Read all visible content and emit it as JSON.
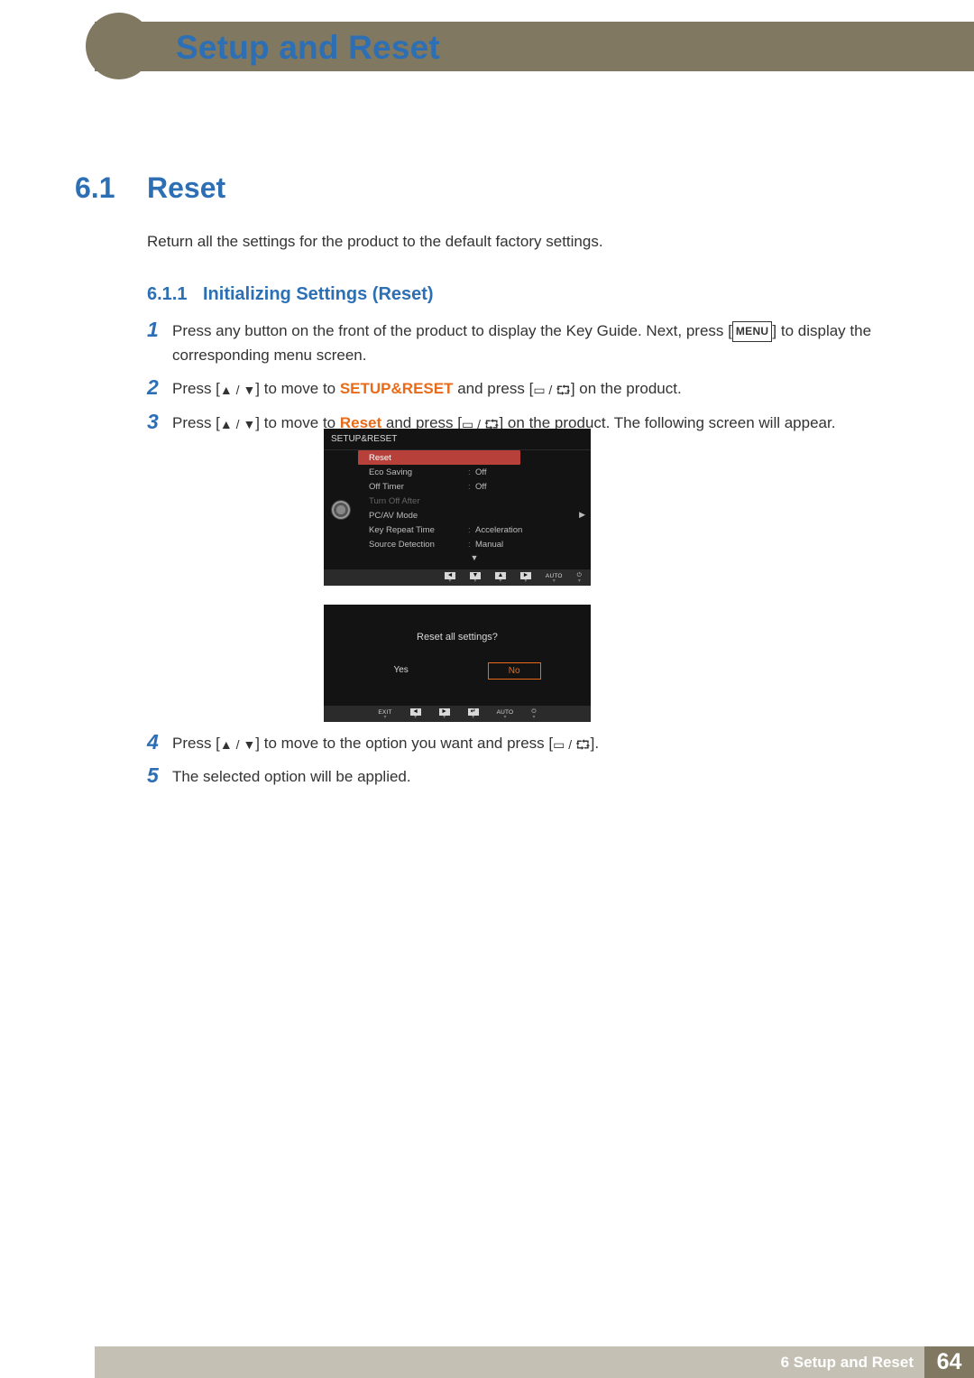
{
  "header": {
    "chapter_title": "Setup and Reset"
  },
  "section": {
    "num": "6.1",
    "title": "Reset",
    "intro": "Return all the settings for the product to the default factory settings."
  },
  "subsection": {
    "num": "6.1.1",
    "title": "Initializing Settings (Reset)"
  },
  "steps": {
    "s1_a": "Press any button on the front of the product to display the Key Guide. Next, press [",
    "s1_menu": "MENU",
    "s1_b": "] to display the corresponding menu screen.",
    "s2_a": "Press [",
    "s2_b": "] to move to ",
    "s2_kw": "SETUP&RESET",
    "s2_c": " and press [",
    "s2_d": "] on the product.",
    "s3_a": "Press [",
    "s3_b": "] to move to ",
    "s3_kw": "Reset",
    "s3_c": " and press [",
    "s3_d": "] on the product. The following screen will appear.",
    "s4_a": "Press [",
    "s4_b": "] to move to the option you want and press [",
    "s4_c": "].",
    "s5": "The selected option will be applied."
  },
  "nums": {
    "n1": "1",
    "n2": "2",
    "n3": "3",
    "n4": "4",
    "n5": "5"
  },
  "osd1": {
    "title": "SETUP&RESET",
    "rows": [
      {
        "label": "Reset",
        "val": "",
        "selected": true
      },
      {
        "label": "Eco Saving",
        "val": "Off"
      },
      {
        "label": "Off Timer",
        "val": "Off"
      },
      {
        "label": "Turn Off After",
        "val": "",
        "disabled": true
      },
      {
        "label": "PC/AV Mode",
        "val": ""
      },
      {
        "label": "Key Repeat Time",
        "val": "Acceleration"
      },
      {
        "label": "Source Detection",
        "val": "Manual"
      }
    ],
    "footer": [
      "◄",
      "▼",
      "▲",
      "►",
      "AUTO",
      "⏻"
    ]
  },
  "osd2": {
    "question": "Reset all settings?",
    "yes": "Yes",
    "no": "No",
    "footer_exit": "EXIT",
    "footer": [
      "◄",
      "►",
      "↵",
      "AUTO",
      "⏻"
    ]
  },
  "footer": {
    "label": "6  Setup and Reset",
    "page": "64"
  },
  "sym": {
    "up": "▲",
    "down": "▼",
    "slash": " / ",
    "rect": "▭",
    "enter": "⮔"
  }
}
